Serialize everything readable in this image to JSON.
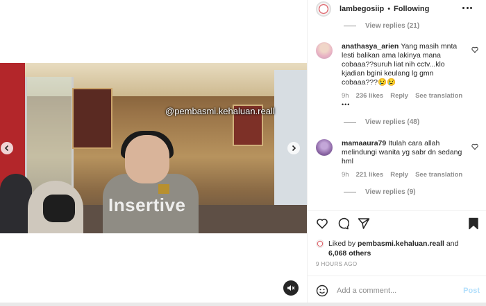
{
  "post": {
    "username": "lambegosiip",
    "separator": "•",
    "follow_status": "Following",
    "media": {
      "watermark": "@pembasmi.kehaluan.reall",
      "video_logo": "Insertive"
    }
  },
  "comments": {
    "top_view_replies": "View replies (21)",
    "items": [
      {
        "username": "anathasya_arien",
        "text": "Yang masih mnta lesti balikan ama lakinya mana cobaaa??suruh liat nih cctv...klo kjadian bgini keulang lg gmn cobaaa???😢😢",
        "time": "9h",
        "likes": "236 likes",
        "reply": "Reply",
        "translate": "See translation",
        "more": "•••",
        "view_replies": "View replies (48)"
      },
      {
        "username": "mamaaura79",
        "text": "Itulah cara allah melindungi wanita yg sabr dn sedang hml",
        "time": "9h",
        "likes": "221 likes",
        "reply": "Reply",
        "translate": "See translation",
        "view_replies": "View replies (9)"
      }
    ]
  },
  "likes": {
    "prefix": "Liked by",
    "user": "pembasmi.kehaluan.reall",
    "conjunction": "and",
    "others": "6,068 others"
  },
  "timestamp": "9 HOURS AGO",
  "composer": {
    "placeholder": "Add a comment...",
    "post_label": "Post"
  },
  "icons": {
    "nav_prev": "chevron-left-icon",
    "nav_next": "chevron-right-icon",
    "mute": "speaker-muted-icon",
    "more": "more-horizontal-icon",
    "like": "heart-icon",
    "comment": "comment-bubble-icon",
    "share": "paper-plane-icon",
    "save": "bookmark-icon",
    "emoji": "smiley-icon"
  },
  "colors": {
    "accent_disabled": "#b2dffc",
    "muted_text": "#8e8e8e",
    "text": "#262626"
  }
}
